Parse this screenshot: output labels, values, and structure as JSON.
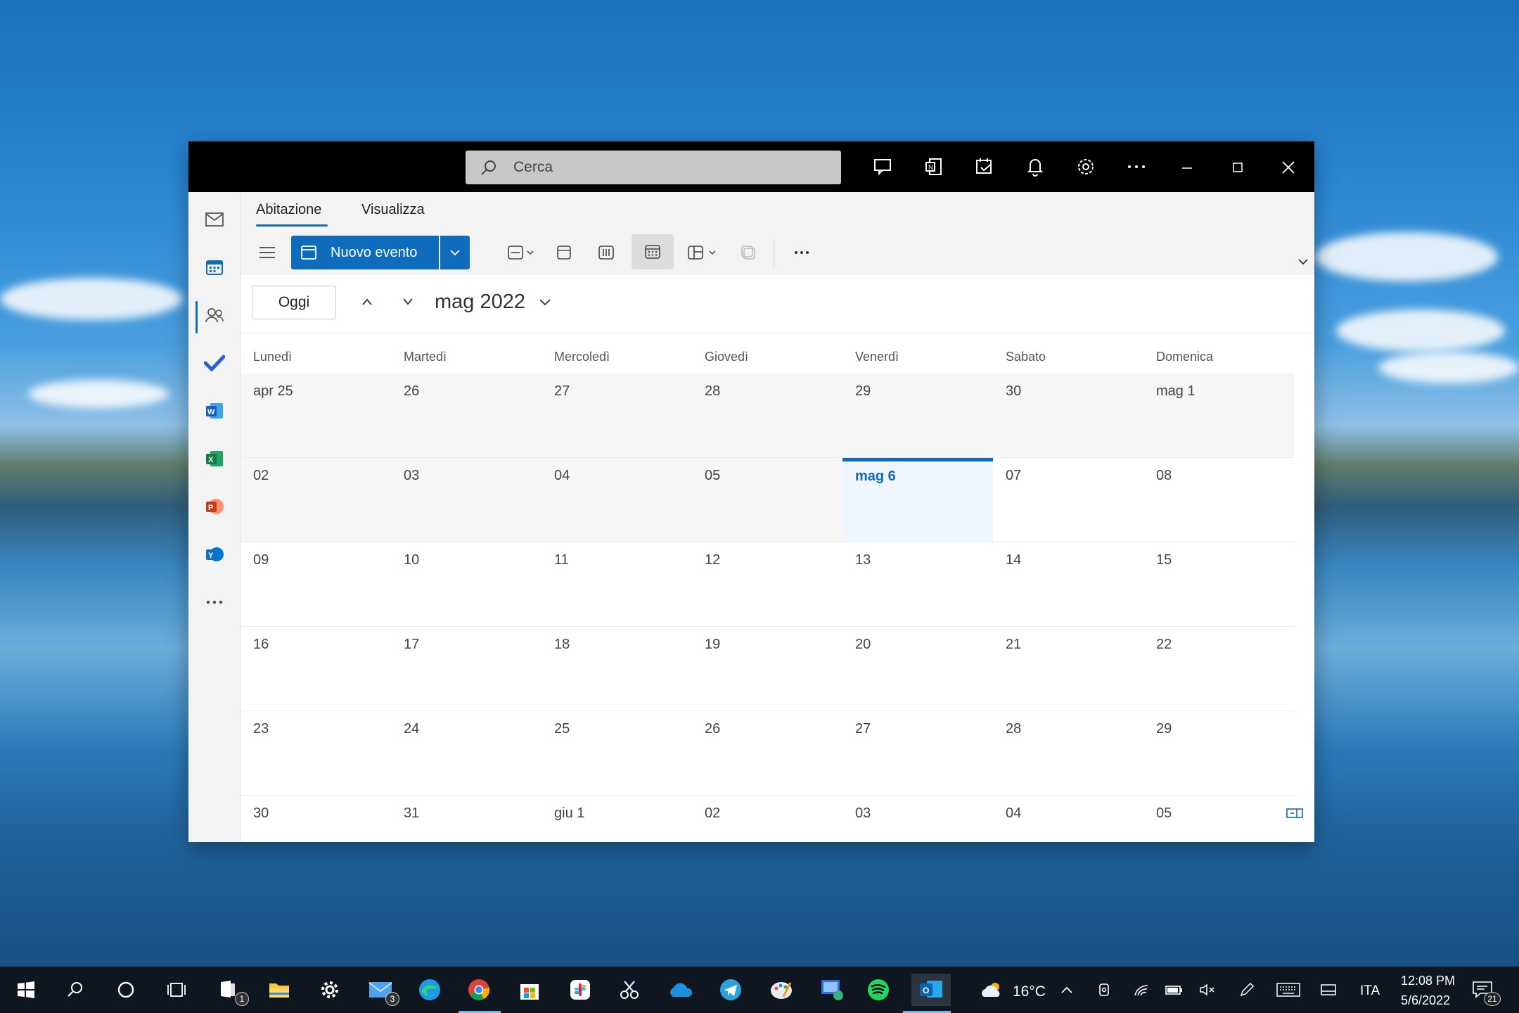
{
  "window": {
    "search_placeholder": "Cerca",
    "tabs": [
      "Abitazione",
      "Visualizza"
    ],
    "new_event_label": "Nuovo evento",
    "today_label": "Oggi",
    "month_label": "mag 2022"
  },
  "calendar": {
    "day_names": [
      "Lunedì",
      "Martedì",
      "Mercoledì",
      "Giovedì",
      "Venerdì",
      "Sabato",
      "Domenica"
    ],
    "weeks": [
      [
        "apr 25",
        "26",
        "27",
        "28",
        "29",
        "30",
        "mag 1"
      ],
      [
        "02",
        "03",
        "04",
        "05",
        "mag 6",
        "07",
        "08"
      ],
      [
        "09",
        "10",
        "11",
        "12",
        "13",
        "14",
        "15"
      ],
      [
        "16",
        "17",
        "18",
        "19",
        "20",
        "21",
        "22"
      ],
      [
        "23",
        "24",
        "25",
        "26",
        "27",
        "28",
        "29"
      ],
      [
        "30",
        "31",
        "giu 1",
        "02",
        "03",
        "04",
        "05"
      ]
    ],
    "today": "mag 6"
  },
  "taskbar": {
    "weather_temp": "16°C",
    "language": "ITA",
    "time": "12:08 PM",
    "date": "5/6/2022",
    "notifications_count": "21",
    "mail_badge": "3",
    "files_badge": "1"
  },
  "colors": {
    "accent": "#0f6cbd",
    "titlebar": "#000000",
    "taskbar": "#0f1620"
  }
}
